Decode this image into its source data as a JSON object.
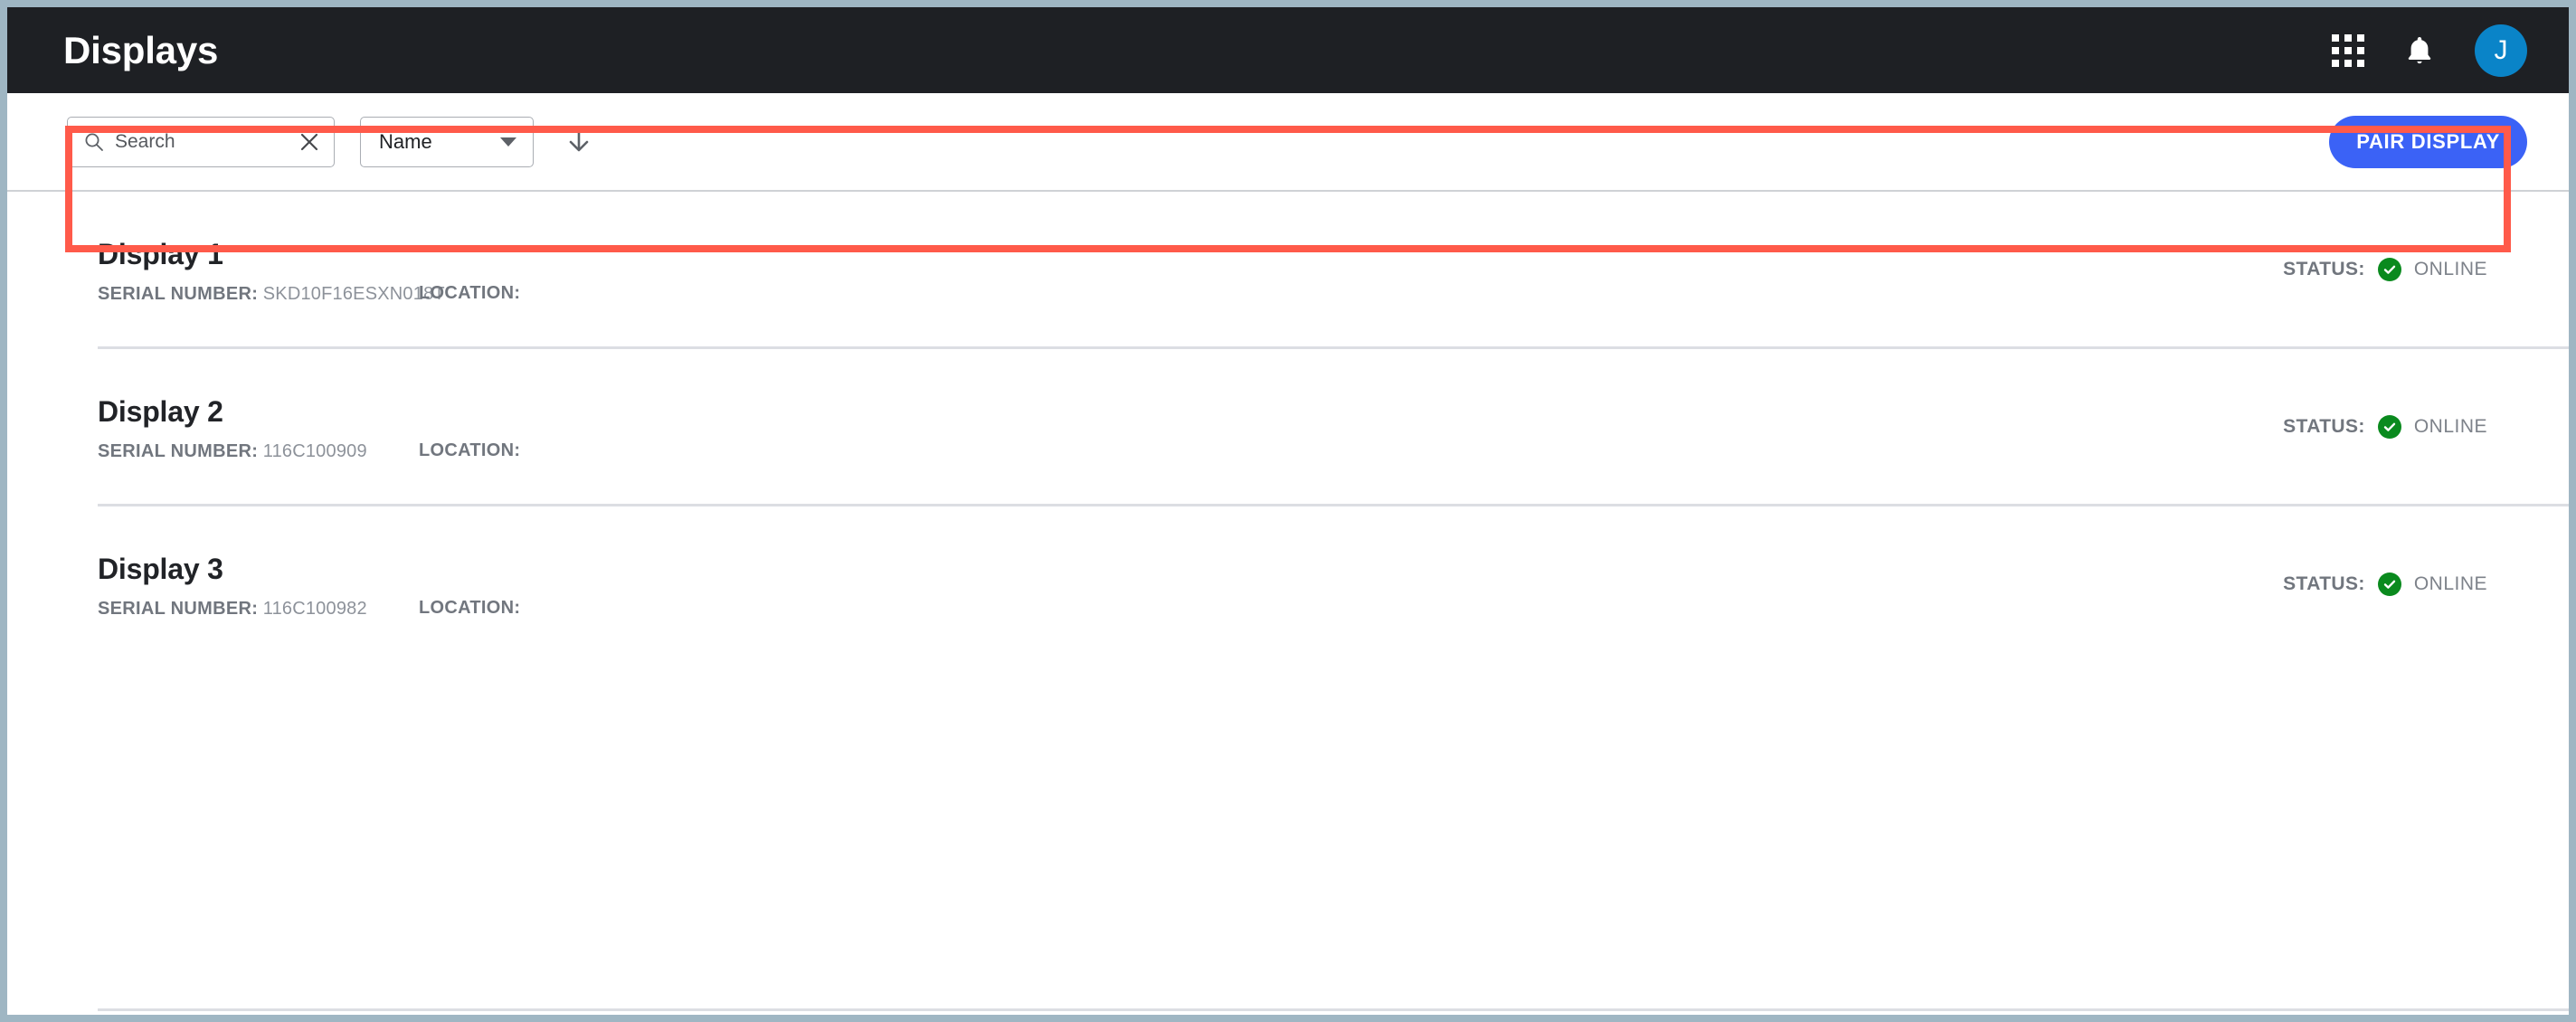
{
  "appbar": {
    "title": "Displays",
    "apps_icon": "grid-apps-icon",
    "notifications_icon": "bell-icon",
    "avatar_initial": "J",
    "avatar_color": "#0a84c8",
    "background_color": "#1e2024"
  },
  "toolbar": {
    "search": {
      "placeholder": "Search",
      "value": "",
      "search_icon": "search-icon",
      "clear_icon": "close-icon"
    },
    "sort_by": {
      "selected": "Name",
      "caret_icon": "chevron-down-icon"
    },
    "sort_direction": {
      "icon": "arrow-down-icon",
      "label": "Descending"
    },
    "pair_display_label": "PAIR DISPLAY",
    "pair_display_color": "#3b62f6"
  },
  "list": {
    "labels": {
      "serial_number": "SERIAL NUMBER:",
      "location": "LOCATION:",
      "status": "STATUS:"
    },
    "rows": [
      {
        "name": "Display 1",
        "serial_number": "SKD10F16ESXN018T",
        "location": "",
        "status": "ONLINE",
        "status_color": "#0a8a1e",
        "highlighted": true
      },
      {
        "name": "Display 2",
        "serial_number": "116C100909",
        "location": "",
        "status": "ONLINE",
        "status_color": "#0a8a1e",
        "highlighted": false
      },
      {
        "name": "Display 3",
        "serial_number": "116C100982",
        "location": "",
        "status": "ONLINE",
        "status_color": "#0a8a1e",
        "highlighted": false
      }
    ]
  },
  "annotation": {
    "highlight_color": "#ff5a4a",
    "target": "Display 1"
  }
}
